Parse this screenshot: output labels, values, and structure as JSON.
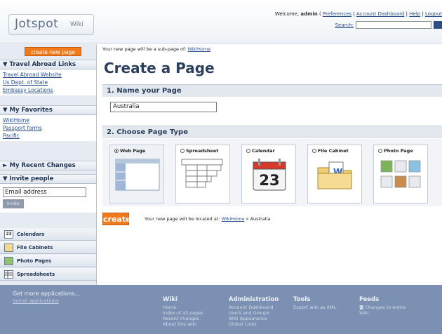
{
  "header": {
    "logo_text": "Jotspot",
    "logo_sub": "Wiki",
    "welcome_prefix": "Welcome, ",
    "username": "admin",
    "links": [
      "Preferences",
      "Account Dashboard",
      "Help",
      "Logout"
    ],
    "search_label": "Search:"
  },
  "sidebar": {
    "create_label": "create new page",
    "travel": {
      "title": "Travel Abroad Links",
      "links": [
        "Travel Abroad Website",
        "Us Dept. of State",
        "Embassy Locations"
      ]
    },
    "favorites": {
      "title": "My Favorites",
      "links": [
        "WikiHome",
        "Passport forms",
        "Pacific"
      ]
    },
    "recent": {
      "title": "My Recent Changes"
    },
    "invite": {
      "title": "Invite people",
      "email_value": "Email address",
      "button": "invite"
    },
    "apps": [
      {
        "label": "Calendars",
        "icon": "calendar-icon",
        "glyph": "23"
      },
      {
        "label": "File Cabinets",
        "icon": "file-cabinet-icon",
        "glyph": ""
      },
      {
        "label": "Photo Pages",
        "icon": "photo-icon",
        "glyph": ""
      },
      {
        "label": "Spreadsheets",
        "icon": "spreadsheet-icon",
        "glyph": ""
      }
    ]
  },
  "main": {
    "subpage_prefix": "Your new page will be a sub-page of: ",
    "subpage_parent": "WikiHome",
    "title": "Create a Page",
    "step1": "1. Name your Page",
    "name_value": "Australia",
    "step2": "2. Choose Page Type",
    "types": [
      {
        "label": "Web Page",
        "selected": true
      },
      {
        "label": "Spreadsheet",
        "selected": false
      },
      {
        "label": "Calendar",
        "selected": false,
        "day": "23"
      },
      {
        "label": "File Cabinet",
        "selected": false
      },
      {
        "label": "Photo Page",
        "selected": false
      }
    ],
    "create_button": "create",
    "location_prefix": "Your new page will be located at: ",
    "location_parent": "WikiHome",
    "location_suffix": " » Australia"
  },
  "footer": {
    "more": "Get more applications...",
    "install": "Install applications",
    "wiki": {
      "title": "Wiki",
      "items": [
        "Home",
        "Index of all pages",
        "Recent changes",
        "About this wiki"
      ]
    },
    "admin": {
      "title": "Administration",
      "items": [
        "Account Dashboard",
        "Users and Groups",
        "Wiki Appearance",
        "Global Links"
      ]
    },
    "tools": {
      "title": "Tools",
      "items": [
        "Export wiki as XML"
      ]
    },
    "feeds": {
      "title": "Feeds",
      "items": [
        "Changes to entire",
        "Wiki"
      ]
    }
  },
  "colors": {
    "accent": "#f07a1c",
    "brand": "#2c3f5c",
    "footer": "#7b90b2"
  }
}
